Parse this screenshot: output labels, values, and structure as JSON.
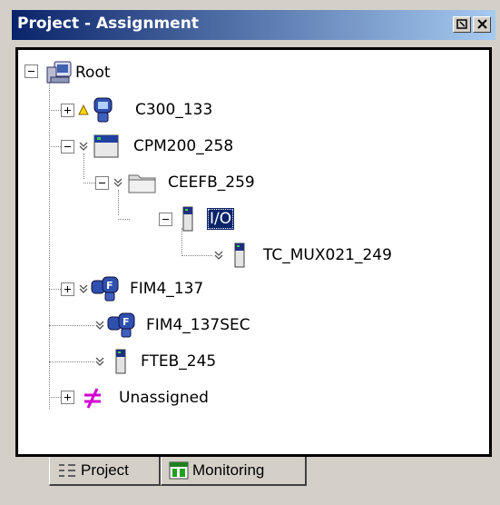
{
  "window": {
    "title": "Project - Assignment"
  },
  "tree": {
    "root": {
      "label": "Root"
    },
    "nodes": [
      {
        "label": "C300_133"
      },
      {
        "label": "CPM200_258"
      },
      {
        "label": "CEEFB_259"
      },
      {
        "label": "I/O"
      },
      {
        "label": "TC_MUX021_249"
      },
      {
        "label": "FIM4_137"
      },
      {
        "label": "FIM4_137SEC"
      },
      {
        "label": "FTEB_245"
      },
      {
        "label": "Unassigned"
      }
    ],
    "selected": "I/O",
    "icons": {
      "root": "computer-icon",
      "controller": "controller-module-icon",
      "folder": "folder-icon",
      "io": "io-module-icon",
      "fim": "fieldbus-module-icon",
      "unassigned": "unassigned-icon",
      "warning": "warning-icon",
      "state": "double-chevron-icon"
    }
  },
  "tabs": [
    {
      "label": "Project",
      "active": true
    },
    {
      "label": "Monitoring",
      "active": false
    }
  ],
  "colors": {
    "title_gradient_start": "#0a246a",
    "title_gradient_end": "#a6caf0",
    "selection": "#0a246a",
    "window_face": "#d4d0c8",
    "warning": "#ffd800",
    "unassigned": "#d000d0"
  }
}
